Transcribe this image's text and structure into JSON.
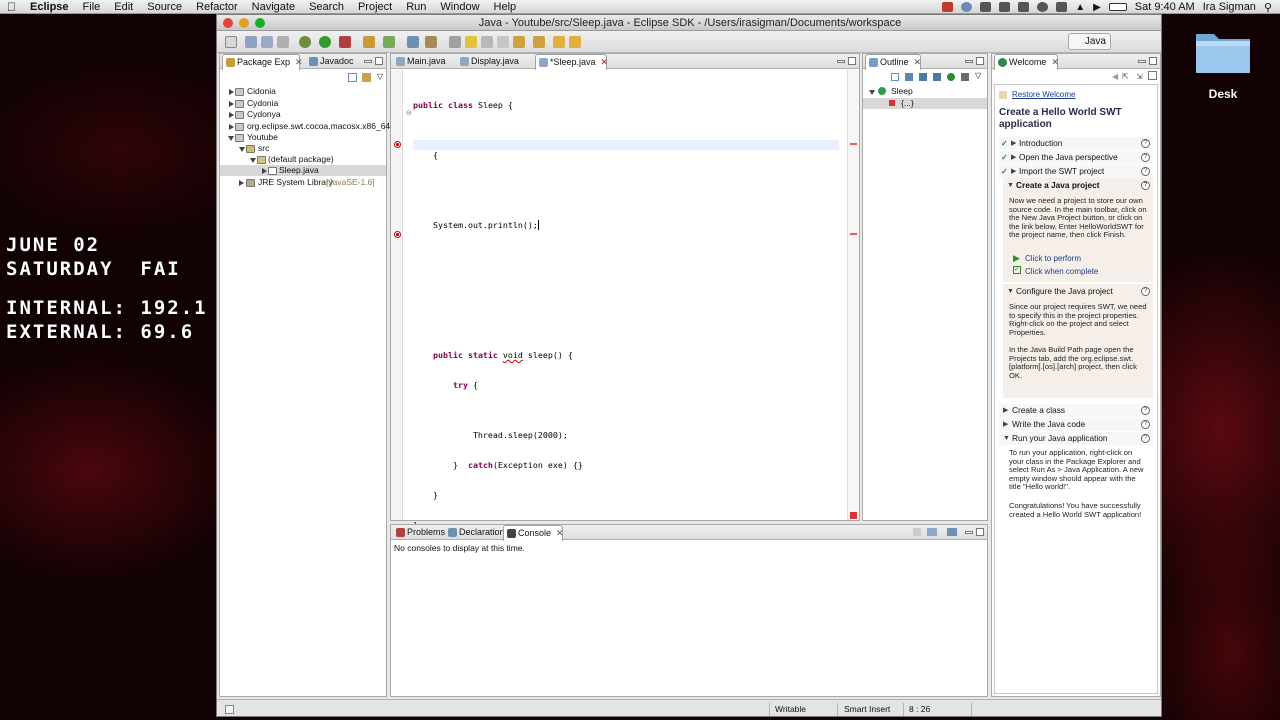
{
  "menubar": {
    "app": "Eclipse",
    "items": [
      "File",
      "Edit",
      "Source",
      "Refactor",
      "Navigate",
      "Search",
      "Project",
      "Run",
      "Window",
      "Help"
    ],
    "clock": "Sat 9:40 AM",
    "user": "Ira Sigman"
  },
  "desktop": {
    "line1": "JUNE 02",
    "line2": "SATURDAY  FAI",
    "line3": "INTERNAL: 192.1",
    "line4": "EXTERNAL: 69.6",
    "folder_label": "Desk"
  },
  "window": {
    "title": "Java - Youtube/src/Sleep.java - Eclipse SDK - /Users/irasigman/Documents/workspace",
    "perspective": "Java"
  },
  "package_explorer": {
    "tabs": [
      "Package Exp",
      "Javadoc"
    ],
    "rows": [
      "Cidonia",
      "Cydonia",
      "Cydonya",
      "org.eclipse.swt.cocoa.macosx.x86_64",
      "Youtube",
      "src",
      "(default package)",
      "Sleep.java",
      "JRE System Library"
    ],
    "jre_version": "[JavaSE-1.6]"
  },
  "editor": {
    "tabs": [
      "Main.java",
      "Display.java",
      "*Sleep.java"
    ],
    "lines": [
      "public class Sleep {",
      "",
      "    {",
      "",
      "",
      "    System.out.println();",
      "",
      "",
      "",
      "",
      "",
      "    public static void sleep() {",
      "        try {",
      "",
      "            Thread.sleep(2000);",
      "        }  catch(Exception exe) {}",
      "    }",
      "}",
      "",
      "",
      "",
      "",
      "",
      "}"
    ]
  },
  "outline": {
    "tab": "Outline",
    "root": "Sleep",
    "child": "{...}"
  },
  "welcome": {
    "tab": "Welcome",
    "restore": "Restore Welcome",
    "title": "Create a Hello World SWT application",
    "s1": "Introduction",
    "s2": "Open the Java perspective",
    "s3": "Import the SWT project",
    "s4": "Create a Java project",
    "s4_text": "Now we need a project to store our own source code. In the main toolbar, click on the New Java Project button, or click on the link below. Enter HelloWorldSWT for the project name, then click Finish.",
    "perform": "Click to perform",
    "complete": "Click when complete",
    "s5": "Configure the Java project",
    "s5_text1": "Since our project requires SWT, we need to specify this in the project properties. Right-click on the project and select Properties.",
    "s5_text2": "In the Java Build Path page open the Projects tab, add the org.eclipse.swt.[platform].[os].[arch] project, then click OK.",
    "s6": "Create a class",
    "s7": "Write the Java code",
    "s8": "Run your Java application",
    "s8_text1": "To run your application, right-click on your class in the Package Explorer and select Run As > Java Application. A new empty window should appear with the title \"Hello world!\".",
    "s8_text2": "Congratulations! You have successfully created a Hello World SWT application!"
  },
  "console": {
    "tabs": [
      "Problems",
      "Declaration",
      "Console"
    ],
    "message": "No consoles to display at this time."
  },
  "status": {
    "writable": "Writable",
    "insert": "Smart Insert",
    "position": "8 : 26"
  }
}
